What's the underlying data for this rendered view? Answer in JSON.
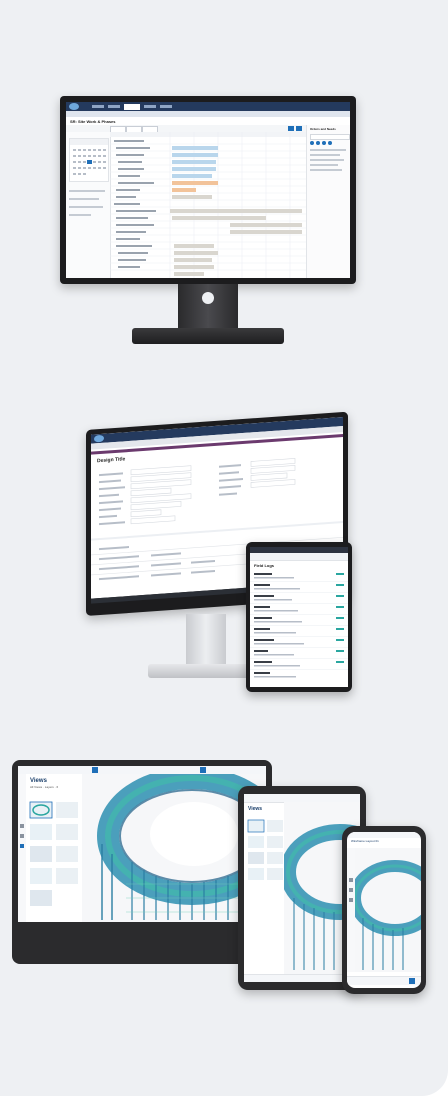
{
  "app": {
    "hero_title": "SR: Site Work & Phases",
    "mobile_header": "Field Logs",
    "design_header": "Design Title",
    "pane_title": "Orders and Needs",
    "views_title": "Views",
    "views_subtitle": "All Views · Layers · 6",
    "phone_header": "Wireframe Layout 01"
  },
  "colors": {
    "accent": "#1f6fb8",
    "bezel": "#1c1c1e",
    "page_bg": "#eef0f3",
    "gantt_blue": "#b9d6ec",
    "gantt_orange": "#f2c39a",
    "gantt_grey": "#d9d6cf",
    "form_purple": "#6b3a6e",
    "model_teal": "#2aa6a0"
  },
  "icons": [
    "monitor-icon",
    "imac-icon",
    "tablet-icon",
    "phone-icon",
    "gear-icon",
    "search-icon",
    "close-icon"
  ]
}
